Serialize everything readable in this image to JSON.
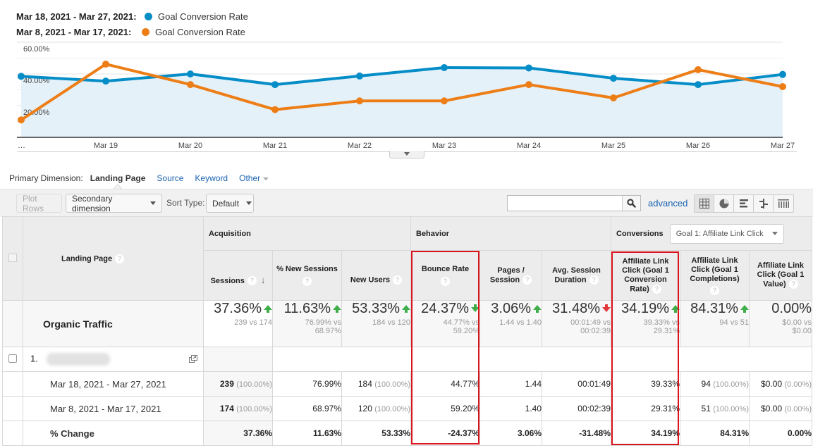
{
  "legend": [
    {
      "range": "Mar 18, 2021 - Mar 27, 2021:",
      "metric": "Goal Conversion Rate",
      "color": "#058dc7"
    },
    {
      "range": "Mar 8, 2021 - Mar 17, 2021:",
      "metric": "Goal Conversion Rate",
      "color": "#ed7e17"
    }
  ],
  "chart_data": {
    "type": "line",
    "title": "",
    "x": [
      "…",
      "Mar 19",
      "Mar 20",
      "Mar 21",
      "Mar 22",
      "Mar 23",
      "Mar 24",
      "Mar 25",
      "Mar 26",
      "Mar 27"
    ],
    "series": [
      {
        "name": "Mar 18, 2021 - Mar 27, 2021: Goal Conversion Rate",
        "color": "#058dc7",
        "values": [
          38.5,
          35.5,
          40.0,
          33.3,
          38.7,
          44.0,
          43.8,
          37.3,
          33.3,
          39.7
        ],
        "area": true
      },
      {
        "name": "Mar 8, 2021 - Mar 17, 2021: Goal Conversion Rate",
        "color": "#ed7e17",
        "values": [
          11.0,
          46.2,
          33.3,
          17.5,
          23.0,
          23.0,
          33.3,
          24.9,
          42.7,
          32.0
        ]
      }
    ],
    "yticks": [
      "20.00%",
      "40.00%",
      "60.00%"
    ],
    "ytick_values": [
      20,
      40,
      60
    ],
    "ylim": [
      0,
      60
    ],
    "xlabel": "",
    "ylabel": "",
    "grid": true
  },
  "dimensions": {
    "label": "Primary Dimension:",
    "active": "Landing Page",
    "links": [
      "Source",
      "Keyword",
      "Other"
    ]
  },
  "toolbar": {
    "plot_rows": "Plot Rows",
    "secondary_dimension": "Secondary dimension",
    "sort_type_label": "Sort Type:",
    "sort_type_value": "Default",
    "search_value": "",
    "advanced": "advanced"
  },
  "table": {
    "landing_page_header": "Landing Page",
    "groups": {
      "acquisition": "Acquisition",
      "behavior": "Behavior",
      "conversions": "Conversions"
    },
    "goal_select": "Goal 1: Affiliate Link Click",
    "columns": [
      "Sessions",
      "% New Sessions",
      "New Users",
      "Bounce Rate",
      "Pages / Session",
      "Avg. Session Duration",
      "Affiliate Link Click (Goal 1 Conversion Rate)",
      "Affiliate Link Click (Goal 1 Completions)",
      "Affiliate Link Click (Goal 1 Value)"
    ],
    "total": {
      "label": "Organic Traffic",
      "cells": [
        {
          "value": "37.36%",
          "trend": "up",
          "sub1": "239 vs 174",
          "sub2": ""
        },
        {
          "value": "11.63%",
          "trend": "up",
          "sub1": "76.99% vs",
          "sub2": "68.97%"
        },
        {
          "value": "53.33%",
          "trend": "up",
          "sub1": "184 vs 120",
          "sub2": ""
        },
        {
          "value": "24.37%",
          "trend": "down-good",
          "sub1": "44.77% vs",
          "sub2": "59.20%"
        },
        {
          "value": "3.06%",
          "trend": "up",
          "sub1": "1.44 vs 1.40",
          "sub2": ""
        },
        {
          "value": "31.48%",
          "trend": "down-bad",
          "sub1": "00:01:49 vs",
          "sub2": "00:02:39"
        },
        {
          "value": "34.19%",
          "trend": "up",
          "sub1": "39.33% vs",
          "sub2": "29.31%"
        },
        {
          "value": "84.31%",
          "trend": "up",
          "sub1": "94 vs 51",
          "sub2": ""
        },
        {
          "value": "0.00%",
          "trend": "none",
          "sub1": "$0.00 vs",
          "sub2": "$0.00"
        }
      ]
    },
    "item": {
      "index": "1.",
      "name_redacted": true
    },
    "rows": [
      {
        "label": "Mar 18, 2021 - Mar 27, 2021",
        "cells": [
          {
            "v": "239",
            "p": "(100.00%)",
            "bold": true
          },
          {
            "v": "76.99%"
          },
          {
            "v": "184",
            "p": "(100.00%)"
          },
          {
            "v": "44.77%"
          },
          {
            "v": "1.44"
          },
          {
            "v": "00:01:49"
          },
          {
            "v": "39.33%"
          },
          {
            "v": "94",
            "p": "(100.00%)"
          },
          {
            "v": "$0.00",
            "p": "(0.00%)"
          }
        ]
      },
      {
        "label": "Mar 8, 2021 - Mar 17, 2021",
        "cells": [
          {
            "v": "174",
            "p": "(100.00%)",
            "bold": true
          },
          {
            "v": "68.97%"
          },
          {
            "v": "120",
            "p": "(100.00%)"
          },
          {
            "v": "59.20%"
          },
          {
            "v": "1.40"
          },
          {
            "v": "00:02:39"
          },
          {
            "v": "29.31%"
          },
          {
            "v": "51",
            "p": "(100.00%)"
          },
          {
            "v": "$0.00",
            "p": "(0.00%)"
          }
        ]
      },
      {
        "label": "% Change",
        "change": true,
        "cells": [
          {
            "v": "37.36%"
          },
          {
            "v": "11.63%"
          },
          {
            "v": "53.33%"
          },
          {
            "v": "-24.37%"
          },
          {
            "v": "3.06%"
          },
          {
            "v": "-31.48%"
          },
          {
            "v": "34.19%"
          },
          {
            "v": "84.31%"
          },
          {
            "v": "0.00%"
          }
        ]
      }
    ]
  }
}
